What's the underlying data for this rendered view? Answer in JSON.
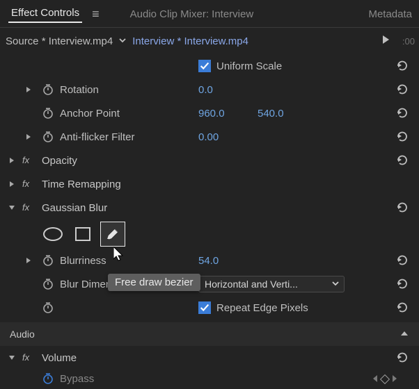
{
  "tabs": {
    "effect_controls": "Effect Controls",
    "audio_clip_mixer": "Audio Clip Mixer: Interview",
    "metadata": "Metadata"
  },
  "source": {
    "source_label": "Source * Interview.mp4",
    "clip_label": "Interview * Interview.mp4",
    "timecode": ":00"
  },
  "uniform_scale": {
    "label": "Uniform Scale",
    "checked": true
  },
  "rotation": {
    "label": "Rotation",
    "value": "0.0"
  },
  "anchor_point": {
    "label": "Anchor Point",
    "x": "960.0",
    "y": "540.0"
  },
  "antiflicker": {
    "label": "Anti-flicker Filter",
    "value": "0.00"
  },
  "opacity": {
    "label": "Opacity"
  },
  "time_remapping": {
    "label": "Time Remapping"
  },
  "gaussian_blur": {
    "label": "Gaussian Blur",
    "blurriness": {
      "label": "Blurriness",
      "value": "54.0"
    },
    "blur_dimensions": {
      "label": "Blur Dimensions",
      "selected": "Horizontal and Verti..."
    },
    "repeat_edge": {
      "label": "Repeat Edge Pixels",
      "checked": true
    }
  },
  "audio": {
    "label": "Audio"
  },
  "volume": {
    "label": "Volume",
    "bypass_label": "Bypass"
  },
  "tooltip": "Free draw bezier"
}
